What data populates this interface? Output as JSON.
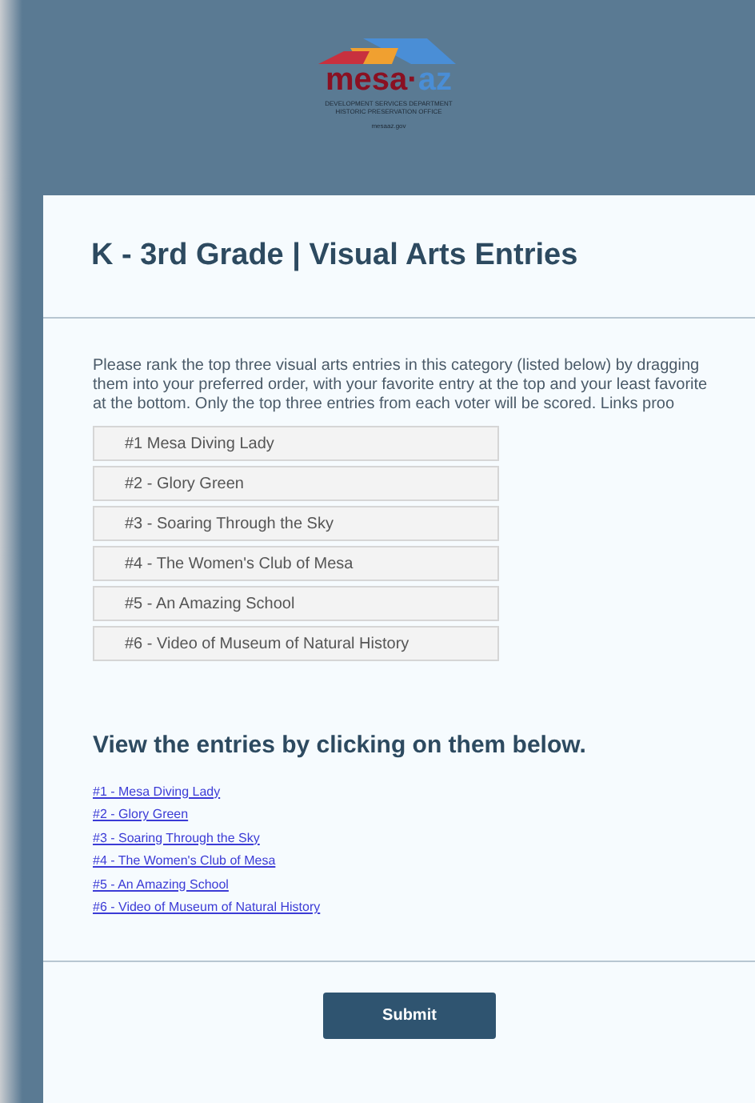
{
  "logo": {
    "wordmark_left": "mesa",
    "separator": "·",
    "wordmark_right": "az",
    "department": "DEVELOPMENT SERVICES DEPARTMENT",
    "office": "HISTORIC PRESERVATION OFFICE",
    "website": "mesaaz.gov"
  },
  "title": "K - 3rd Grade | Visual Arts Entries",
  "instructions": "Please rank the top three visual arts entries in this category (listed below) by dragging them into your preferred order, with your favorite entry at the top and your least favorite at the bottom. Only the top three entries from each voter will be scored. Links proo",
  "ranking_items": [
    "#1 Mesa Diving Lady",
    "#2 - Glory Green",
    "#3 - Soaring Through the Sky",
    "#4 - The Women's Club of Mesa",
    "#5 - An Amazing School",
    "#6 - Video of Museum of Natural History"
  ],
  "links_heading": "View the entries by clicking on them below.",
  "links": [
    "#1 - Mesa Diving Lady",
    "#2 - Glory Green",
    "#3 - Soaring Through the Sky",
    "#4 - The Women's Club of Mesa",
    "#5 - An Amazing School",
    "#6 - Video of Museum of Natural History"
  ],
  "submit": "Submit"
}
